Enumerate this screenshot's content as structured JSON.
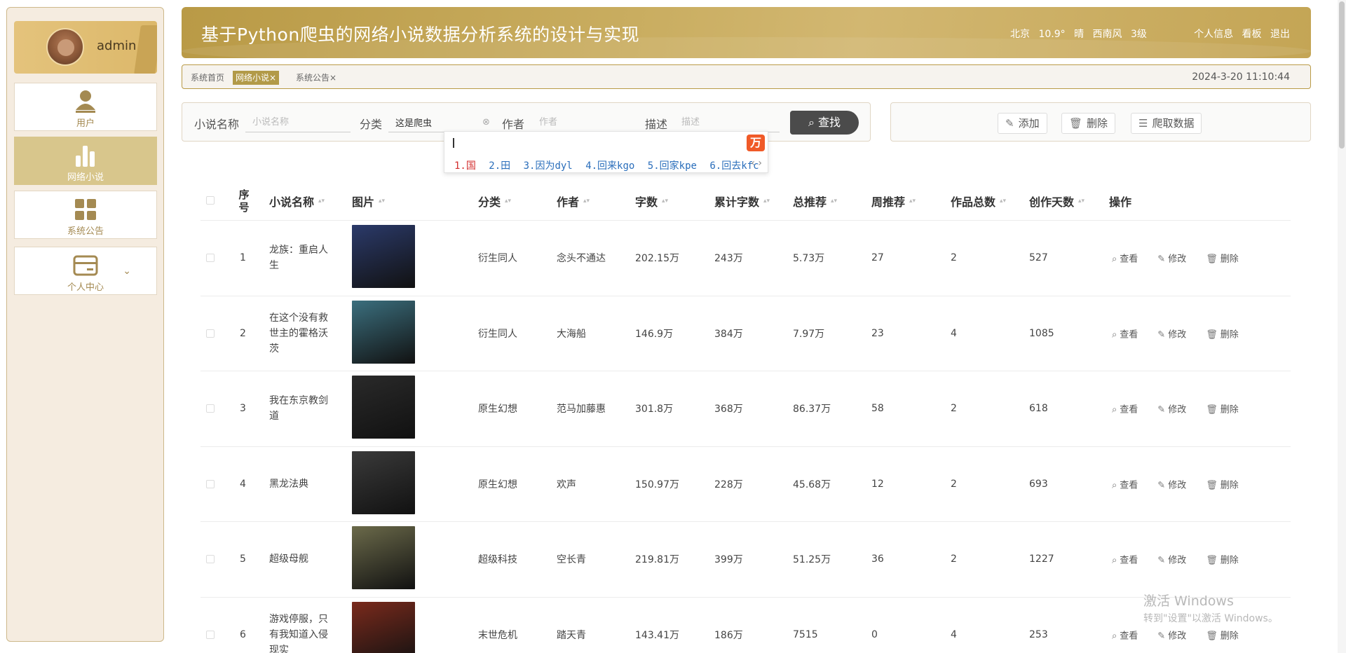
{
  "user": {
    "name": "admin"
  },
  "sidebar": {
    "items": [
      {
        "label": "用户",
        "icon": "user-icon"
      },
      {
        "label": "网络小说",
        "icon": "bar-chart-icon"
      },
      {
        "label": "系统公告",
        "icon": "grid-icon"
      },
      {
        "label": "个人中心",
        "icon": "wallet-icon"
      }
    ]
  },
  "header": {
    "title": "基于Python爬虫的网络小说数据分析系统的设计与实现",
    "weather": {
      "city": "北京",
      "temp": "10.9°",
      "condition": "晴",
      "wind": "西南风",
      "level": "3级"
    },
    "links": [
      "个人信息",
      "看板",
      "退出"
    ]
  },
  "tabs": [
    {
      "label": "系统首页",
      "closable": false
    },
    {
      "label": "网络小说",
      "closable": true
    },
    {
      "label": "系统公告",
      "closable": true
    }
  ],
  "datetime": "2024-3-20 11:10:44",
  "search": {
    "name_label": "小说名称",
    "name_placeholder": "小说名称",
    "category_label": "分类",
    "category_value": "这是爬虫",
    "author_label": "作者",
    "author_placeholder": "作者",
    "desc_label": "描述",
    "desc_placeholder": "描述",
    "button": "查找"
  },
  "actions": {
    "add": "添加",
    "delete": "删除",
    "crawl": "爬取数据"
  },
  "ime": {
    "logo": "万",
    "candidates": [
      "1.国",
      "2.田",
      "3.因为dyl",
      "4.回来kgo",
      "5.回家kpe",
      "6.回去kfc"
    ]
  },
  "table": {
    "headers": {
      "index_1": "序",
      "index_2": "号",
      "name": "小说名称",
      "image": "图片",
      "category": "分类",
      "author": "作者",
      "words": "字数",
      "total_words": "累计字数",
      "total_rec": "总推荐",
      "week_rec": "周推荐",
      "works": "作品总数",
      "days": "创作天数",
      "ops": "操作"
    },
    "ops": {
      "view": "查看",
      "edit": "修改",
      "delete": "删除"
    },
    "rows": [
      {
        "index": "1",
        "name": "龙族：重启人生",
        "category": "衍生同人",
        "author": "念头不通达",
        "words": "202.15万",
        "total_words": "243万",
        "total_rec": "5.73万",
        "week_rec": "27",
        "works": "2",
        "days": "527",
        "cover": "#2b3a6a"
      },
      {
        "index": "2",
        "name": "在这个没有救世主的霍格沃茨",
        "category": "衍生同人",
        "author": "大海船",
        "words": "146.9万",
        "total_words": "384万",
        "total_rec": "7.97万",
        "week_rec": "23",
        "works": "4",
        "days": "1085",
        "cover": "#3b6f7e"
      },
      {
        "index": "3",
        "name": "我在东京教剑道",
        "category": "原生幻想",
        "author": "范马加藤惠",
        "words": "301.8万",
        "total_words": "368万",
        "total_rec": "86.37万",
        "week_rec": "58",
        "works": "2",
        "days": "618",
        "cover": "#2a2a2a"
      },
      {
        "index": "4",
        "name": "黑龙法典",
        "category": "原生幻想",
        "author": "欢声",
        "words": "150.97万",
        "total_words": "228万",
        "total_rec": "45.68万",
        "week_rec": "12",
        "works": "2",
        "days": "693",
        "cover": "#3a3a3a"
      },
      {
        "index": "5",
        "name": "超级母舰",
        "category": "超级科技",
        "author": "空长青",
        "words": "219.81万",
        "total_words": "399万",
        "total_rec": "51.25万",
        "week_rec": "36",
        "works": "2",
        "days": "1227",
        "cover": "#6b6a4a"
      },
      {
        "index": "6",
        "name": "游戏停服，只有我知道入侵现实",
        "category": "末世危机",
        "author": "踏天青",
        "words": "143.41万",
        "total_words": "186万",
        "total_rec": "7515",
        "week_rec": "0",
        "works": "4",
        "days": "253",
        "cover": "#7a2a1c"
      }
    ]
  },
  "watermark": {
    "line1": "激活 Windows",
    "line2": "转到\"设置\"以激活 Windows。"
  }
}
